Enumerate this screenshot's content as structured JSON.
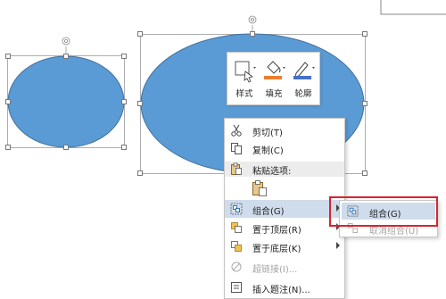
{
  "mini_toolbar": {
    "style_label": "样式",
    "fill_label": "填充",
    "outline_label": "轮廓"
  },
  "context_menu": {
    "items": [
      {
        "label": "剪切(T)",
        "icon": "scissors-icon",
        "enabled": true
      },
      {
        "label": "复制(C)",
        "icon": "copy-icon",
        "enabled": true
      },
      {
        "label": "粘贴选项:",
        "icon": "paste-icon",
        "enabled": true
      },
      {
        "label": "组合(G)",
        "icon": "group-icon",
        "enabled": true,
        "submenu": true,
        "highlighted": true
      },
      {
        "label": "置于顶层(R)",
        "icon": "bring-to-front-icon",
        "enabled": true,
        "submenu": true
      },
      {
        "label": "置于底层(K)",
        "icon": "send-to-back-icon",
        "enabled": true,
        "submenu": true
      },
      {
        "label": "超链接(I)...",
        "icon": "hyperlink-icon",
        "enabled": false
      },
      {
        "label": "插入题注(N)...",
        "icon": "insert-caption-icon",
        "enabled": true
      }
    ]
  },
  "submenu": {
    "items": [
      {
        "label": "组合(G)",
        "icon": "group-icon",
        "enabled": true,
        "highlighted": true
      },
      {
        "label": "取消组合(U)",
        "icon": "ungroup-icon",
        "enabled": false
      }
    ]
  },
  "colors": {
    "shape_fill": "#5b9bd5",
    "shape_stroke": "#41719c",
    "highlight": "#cfdcec",
    "annotation_box": "#d9232e",
    "fill_swatch": "#ed7d31",
    "outline_swatch": "#4472c4"
  }
}
